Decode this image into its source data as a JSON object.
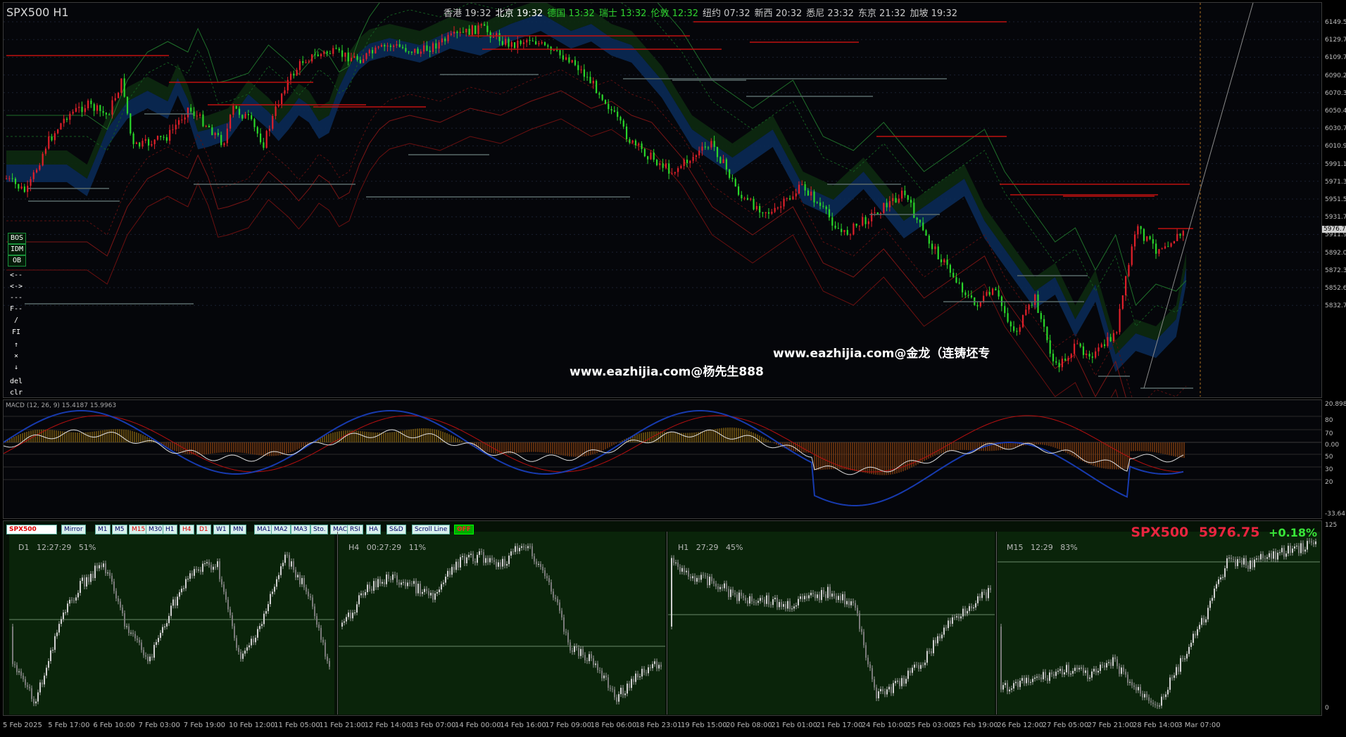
{
  "header": {
    "symbol_tf": "SPX500 H1",
    "clocks": [
      {
        "city": "香港",
        "time": "19:32",
        "color": "#c8c8c8"
      },
      {
        "city": "北京",
        "time": "19:32",
        "color": "#ffffff"
      },
      {
        "city": "德国",
        "time": "13:32",
        "color": "#2fd12f"
      },
      {
        "city": "瑞士",
        "time": "13:32",
        "color": "#2fd12f"
      },
      {
        "city": "伦敦",
        "time": "12:32",
        "color": "#2fd12f"
      },
      {
        "city": "纽约",
        "time": "07:32",
        "color": "#c8c8c8"
      },
      {
        "city": "新西",
        "time": "20:32",
        "color": "#c8c8c8"
      },
      {
        "city": "悉尼",
        "time": "23:32",
        "color": "#c8c8c8"
      },
      {
        "city": "东京",
        "time": "21:32",
        "color": "#c8c8c8"
      },
      {
        "city": "加坡",
        "time": "19:32",
        "color": "#c8c8c8"
      }
    ]
  },
  "tools": [
    "BOS",
    "IDM",
    "OB",
    "<--",
    "<->",
    "---",
    "F--",
    "/",
    "FI",
    "↑",
    "×",
    "↓",
    "del",
    "clr"
  ],
  "price_axis": [
    "6149.5",
    "6129.7",
    "6109.7",
    "6090.2",
    "6070.3",
    "6050.4",
    "6030.7",
    "6010.9",
    "5991.1",
    "5971.3",
    "5951.5",
    "5931.7",
    "5911.9",
    "5892.0",
    "5872.3",
    "5852.6",
    "5832.7"
  ],
  "current_price": "5976.7",
  "watermarks": [
    "www.eazhijia.com@金龙（连铸坯专",
    "www.eazhijia.com@杨先生888"
  ],
  "macd": {
    "label": "MACD (12, 26, 9) 15.4187 15.9963",
    "axis": [
      "20.898",
      "80",
      "70",
      "0.00",
      "50",
      "30",
      "20",
      "-33.647"
    ]
  },
  "toolbar": {
    "symbol": "SPX500",
    "buttons": [
      "Mirror",
      "M1",
      "M5",
      "M15",
      "M30",
      "H1",
      "H4",
      "D1",
      "W1",
      "MN",
      "MA1",
      "MA2",
      "MA3",
      "Sto.",
      "MACD",
      "RSI",
      "HA",
      "S&D",
      "Scroll Line"
    ],
    "toggle": "OFF"
  },
  "mini_charts": [
    {
      "tf": "D1",
      "timer": "12:27:29",
      "pct": "51%"
    },
    {
      "tf": "H4",
      "timer": "00:27:29",
      "pct": "11%"
    },
    {
      "tf": "H1",
      "timer": "27:29",
      "pct": "45%"
    },
    {
      "tf": "M15",
      "timer": "12:29",
      "pct": "83%"
    }
  ],
  "quote": {
    "symbol": "SPX500",
    "price": "5976.75",
    "change": "+0.18%"
  },
  "mini_axis": [
    "125",
    "0"
  ],
  "time_axis": [
    "5 Feb 2025",
    "5 Feb 17:00",
    "6 Feb 10:00",
    "7 Feb 03:00",
    "7 Feb 19:00",
    "10 Feb 12:00",
    "11 Feb 05:00",
    "11 Feb 21:00",
    "12 Feb 14:00",
    "13 Feb 07:00",
    "14 Feb 00:00",
    "14 Feb 16:00",
    "17 Feb 09:00",
    "18 Feb 06:00",
    "18 Feb 23:01",
    "19 Feb 15:00",
    "20 Feb 08:00",
    "21 Feb 01:00",
    "21 Feb 17:00",
    "24 Feb 10:00",
    "25 Feb 03:00",
    "25 Feb 19:00",
    "26 Feb 12:00",
    "27 Feb 05:00",
    "27 Feb 21:00",
    "28 Feb 14:00",
    "3 Mar 07:00"
  ],
  "colors": {
    "bull": "#e0202a",
    "bear": "#2ad62a",
    "cloud_blue": "#0a2a55",
    "cloud_green": "#0d2a10",
    "accent_red": "#e8253f",
    "accent_green": "#39e639"
  }
}
